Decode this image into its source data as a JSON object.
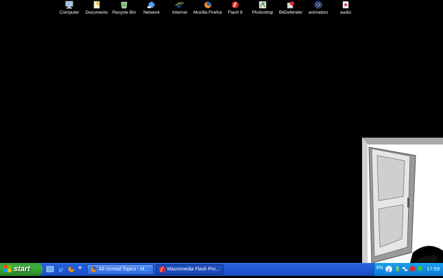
{
  "desktop_icons": [
    {
      "label": "Computer",
      "icon": "computer-icon"
    },
    {
      "label": "Documents",
      "icon": "documents-icon"
    },
    {
      "label": "Recycle Bin",
      "icon": "recycle-bin-icon"
    },
    {
      "label": "Network",
      "icon": "network-icon"
    },
    {
      "label": "Internet",
      "icon": "internet-explorer-icon"
    },
    {
      "label": "Mozilla Firefox",
      "icon": "firefox-icon"
    },
    {
      "label": "Flash 8",
      "icon": "flash-icon"
    },
    {
      "label": "Photoshop",
      "icon": "photoshop-icon"
    },
    {
      "label": "BitDefender",
      "icon": "bitdefender-icon"
    },
    {
      "label": "animation",
      "icon": "gear-icon"
    },
    {
      "label": "audio",
      "icon": "audio-file-icon"
    }
  ],
  "taskbar": {
    "start_label": "start",
    "quick_launch_more": "»",
    "tasks": [
      {
        "label": "All Unread Topics - M...",
        "icon": "firefox-icon"
      },
      {
        "label": "Macromedia Flash Pro...",
        "icon": "flash-icon"
      }
    ],
    "tray": {
      "language": "EN",
      "clock": "17:59"
    }
  },
  "colors": {
    "desktop_background": "#000000",
    "taskbar_blue": "#245edb",
    "start_green": "#3c9c3c",
    "tray_blue": "#0f8ce2"
  }
}
